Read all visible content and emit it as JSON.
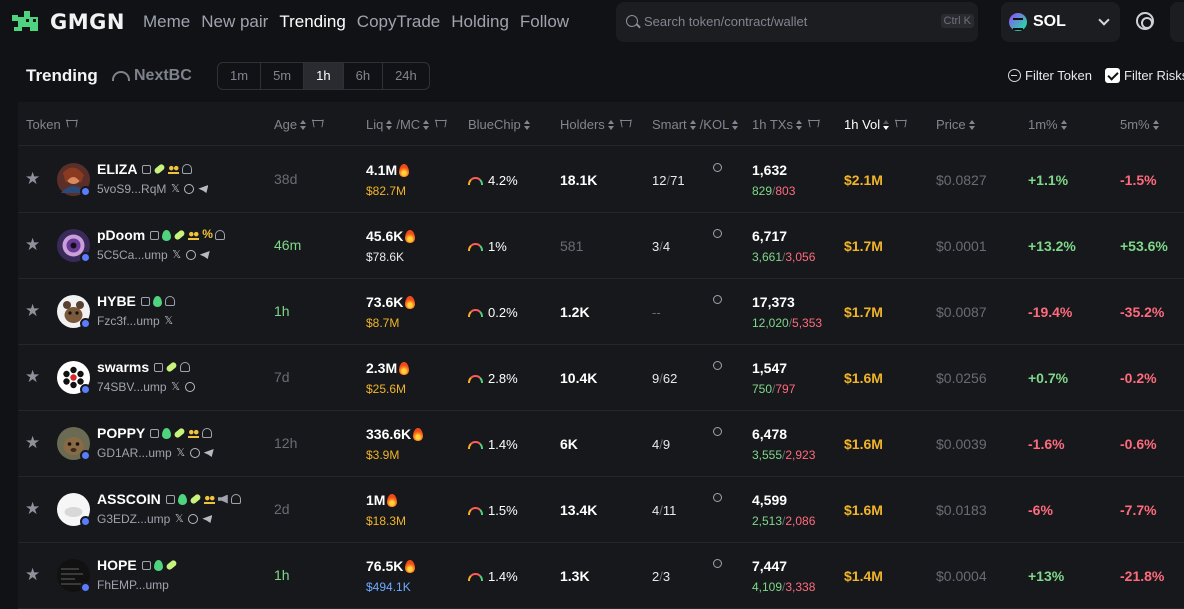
{
  "app": {
    "logo_text": "GMGN",
    "nav": [
      "Meme",
      "New pair",
      "Trending",
      "CopyTrade",
      "Holding",
      "Follow"
    ],
    "nav_active": "Trending",
    "search_placeholder": "Search token/contract/wallet",
    "search_shortcut": "Ctrl K",
    "chain_label": "SOL",
    "icons": [
      "search-icon",
      "gear-icon",
      "chevron-down-icon",
      "star-icon",
      "flame-icon"
    ]
  },
  "subheader": {
    "title": "Trending",
    "nextbc_label": "NextBC",
    "periods": [
      "1m",
      "5m",
      "1h",
      "6h",
      "24h"
    ],
    "period_active": "1h",
    "filter_token_label": "Filter Token",
    "filter_risks_label": "Filter Risks",
    "filter_risks_checked": true
  },
  "table": {
    "headers": {
      "token": "Token",
      "age": "Age",
      "liq": "Liq",
      "mc": "/MC",
      "bluechip": "BlueChip",
      "holders": "Holders",
      "smart": "Smart",
      "kol": "/KOL",
      "txs": "1h TXs",
      "vol": "1h Vol",
      "price": "Price",
      "m1": "1m%",
      "m5": "5m%"
    },
    "rows": [
      {
        "symbol": "ELIZA",
        "address": "5voS9...RqM",
        "age": "38d",
        "liq": "4.1M",
        "mc": "$82.7M",
        "bluechip": "4.2%",
        "holders": "18.1K",
        "smart": "12",
        "kol": "71",
        "txs": "1,632",
        "buys": "829",
        "sells": "803",
        "vol": "$2.1M",
        "price": "$0.0827",
        "m1": "+1.1%",
        "m5": "-1.5%"
      },
      {
        "symbol": "pDoom",
        "address": "5C5Ca...ump",
        "age": "46m",
        "liq": "45.6K",
        "mc": "$78.6K",
        "bluechip": "1%",
        "holders": "581",
        "smart": "3",
        "kol": "4",
        "txs": "6,717",
        "buys": "3,661",
        "sells": "3,056",
        "vol": "$1.7M",
        "price": "$0.0001",
        "m1": "+13.2%",
        "m5": "+53.6%"
      },
      {
        "symbol": "HYBE",
        "address": "Fzc3f...ump",
        "age": "1h",
        "liq": "73.6K",
        "mc": "$8.7M",
        "bluechip": "0.2%",
        "holders": "1.2K",
        "smart": "--",
        "kol": "",
        "txs": "17,373",
        "buys": "12,020",
        "sells": "5,353",
        "vol": "$1.7M",
        "price": "$0.0087",
        "m1": "-19.4%",
        "m5": "-35.2%"
      },
      {
        "symbol": "swarms",
        "address": "74SBV...ump",
        "age": "7d",
        "liq": "2.3M",
        "mc": "$25.6M",
        "bluechip": "2.8%",
        "holders": "10.4K",
        "smart": "9",
        "kol": "62",
        "txs": "1,547",
        "buys": "750",
        "sells": "797",
        "vol": "$1.6M",
        "price": "$0.0256",
        "m1": "+0.7%",
        "m5": "-0.2%"
      },
      {
        "symbol": "POPPY",
        "address": "GD1AR...ump",
        "age": "12h",
        "liq": "336.6K",
        "mc": "$3.9M",
        "bluechip": "1.4%",
        "holders": "6K",
        "smart": "4",
        "kol": "9",
        "txs": "6,478",
        "buys": "3,555",
        "sells": "2,923",
        "vol": "$1.6M",
        "price": "$0.0039",
        "m1": "-1.6%",
        "m5": "-0.6%"
      },
      {
        "symbol": "ASSCOIN",
        "address": "G3EDZ...ump",
        "age": "2d",
        "liq": "1M",
        "mc": "$18.3M",
        "bluechip": "1.5%",
        "holders": "13.4K",
        "smart": "4",
        "kol": "11",
        "txs": "4,599",
        "buys": "2,513",
        "sells": "2,086",
        "vol": "$1.6M",
        "price": "$0.0183",
        "m1": "-6%",
        "m5": "-7.7%"
      },
      {
        "symbol": "HOPE",
        "address": "FhEMP...ump",
        "age": "1h",
        "liq": "76.5K",
        "mc": "$494.1K",
        "bluechip": "1.4%",
        "holders": "1.3K",
        "smart": "2",
        "kol": "3",
        "txs": "7,447",
        "buys": "4,109",
        "sells": "3,338",
        "vol": "$1.4M",
        "price": "$0.0004",
        "m1": "+13%",
        "m5": "-21.8%"
      }
    ]
  },
  "colors": {
    "background": "#111215",
    "panel": "#17181b",
    "positive": "#7fd88a",
    "negative": "#ff6b7d",
    "gold": "#f0b429",
    "muted": "#686c75",
    "brand_green": "#4fd37e"
  }
}
